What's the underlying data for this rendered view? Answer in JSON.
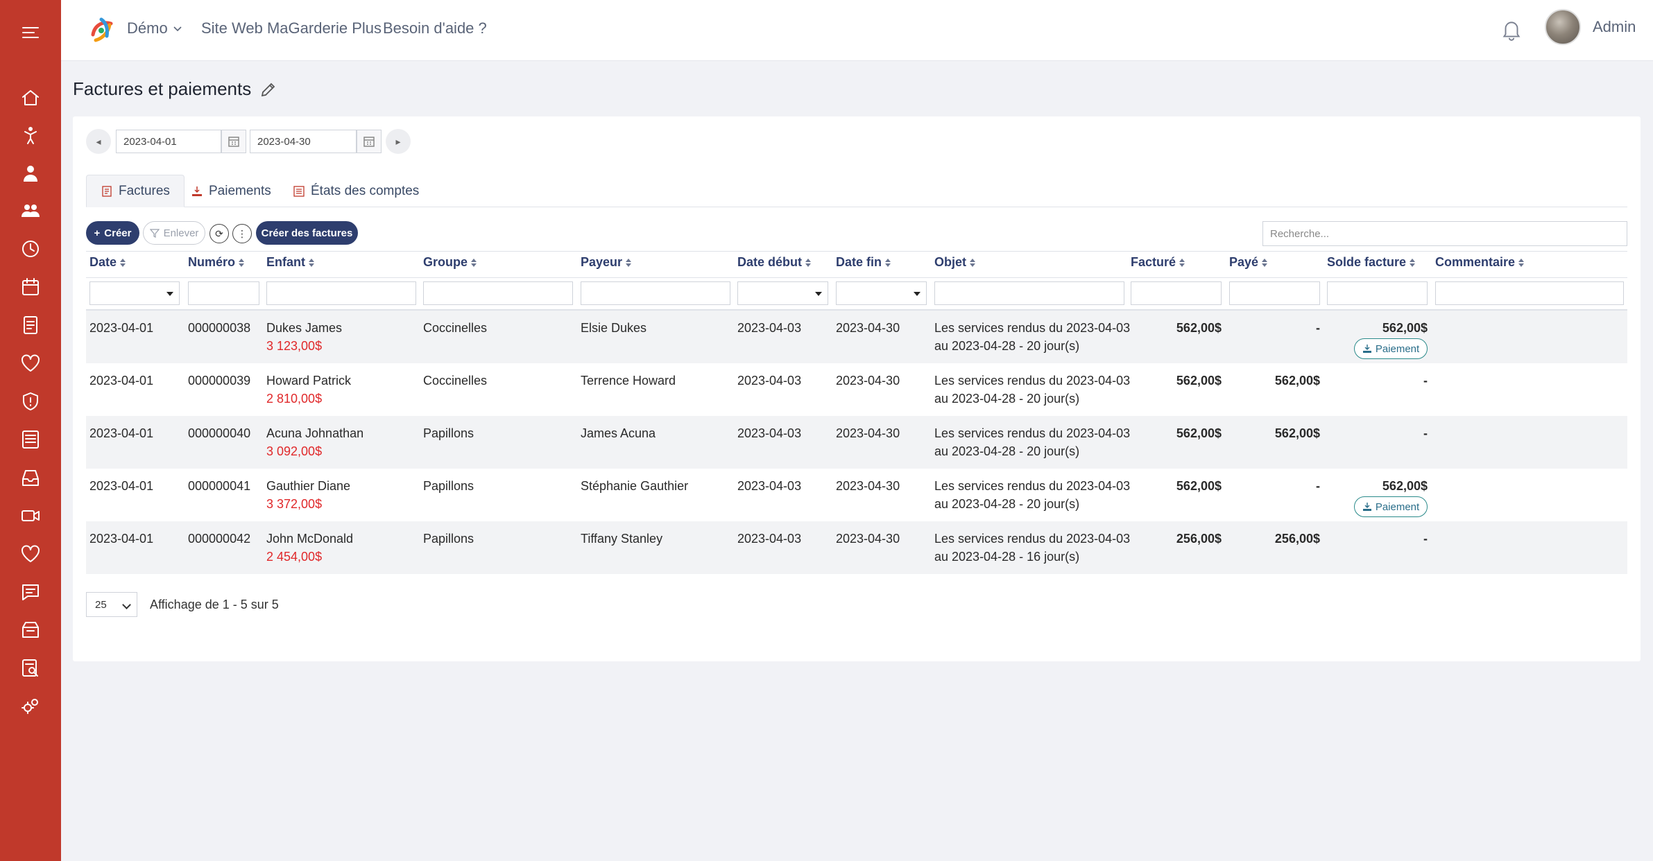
{
  "brand": {
    "name": "Démo"
  },
  "topnav": {
    "link1": "Site Web MaGarderie Plus",
    "link2": "Besoin d'aide ?",
    "user": "Admin"
  },
  "page": {
    "title": "Factures et paiements"
  },
  "dates": {
    "start": "2023-04-01",
    "end": "2023-04-30"
  },
  "tabs": [
    {
      "label": "Factures"
    },
    {
      "label": "Paiements"
    },
    {
      "label": "États des comptes"
    }
  ],
  "toolbar": {
    "create": "Créer",
    "remove": "Enlever",
    "create_invoices": "Créer des factures",
    "search_placeholder": "Recherche..."
  },
  "columns": [
    "Date",
    "Numéro",
    "Enfant",
    "Groupe",
    "Payeur",
    "Date début",
    "Date fin",
    "Objet",
    "Facturé",
    "Payé",
    "Solde facture",
    "Commentaire"
  ],
  "rows": [
    {
      "date": "2023-04-01",
      "numero": "000000038",
      "enfant": "Dukes James",
      "solde_enfant": "3 123,00$",
      "groupe": "Coccinelles",
      "payeur": "Elsie Dukes",
      "debut": "2023-04-03",
      "fin": "2023-04-30",
      "objet1": "Les services rendus du 2023-04-03",
      "objet2": "au 2023-04-28 - 20 jour(s)",
      "facture": "562,00$",
      "paye": "-",
      "solde": "562,00$",
      "paiement": "Paiement"
    },
    {
      "date": "2023-04-01",
      "numero": "000000039",
      "enfant": "Howard Patrick",
      "solde_enfant": "2 810,00$",
      "groupe": "Coccinelles",
      "payeur": "Terrence Howard",
      "debut": "2023-04-03",
      "fin": "2023-04-30",
      "objet1": "Les services rendus du 2023-04-03",
      "objet2": "au 2023-04-28 - 20 jour(s)",
      "facture": "562,00$",
      "paye": "562,00$",
      "solde": "-",
      "paiement": ""
    },
    {
      "date": "2023-04-01",
      "numero": "000000040",
      "enfant": "Acuna Johnathan",
      "solde_enfant": "3 092,00$",
      "groupe": "Papillons",
      "payeur": "James Acuna",
      "debut": "2023-04-03",
      "fin": "2023-04-30",
      "objet1": "Les services rendus du 2023-04-03",
      "objet2": "au 2023-04-28 - 20 jour(s)",
      "facture": "562,00$",
      "paye": "562,00$",
      "solde": "-",
      "paiement": ""
    },
    {
      "date": "2023-04-01",
      "numero": "000000041",
      "enfant": "Gauthier Diane",
      "solde_enfant": "3 372,00$",
      "groupe": "Papillons",
      "payeur": "Stéphanie Gauthier",
      "debut": "2023-04-03",
      "fin": "2023-04-30",
      "objet1": "Les services rendus du 2023-04-03",
      "objet2": "au 2023-04-28 - 20 jour(s)",
      "facture": "562,00$",
      "paye": "-",
      "solde": "562,00$",
      "paiement": "Paiement"
    },
    {
      "date": "2023-04-01",
      "numero": "000000042",
      "enfant": "John McDonald",
      "solde_enfant": "2 454,00$",
      "groupe": "Papillons",
      "payeur": "Tiffany Stanley",
      "debut": "2023-04-03",
      "fin": "2023-04-30",
      "objet1": "Les services rendus du 2023-04-03",
      "objet2": "au 2023-04-28 - 16 jour(s)",
      "facture": "256,00$",
      "paye": "256,00$",
      "solde": "-",
      "paiement": ""
    }
  ],
  "pagination": {
    "page_size": "25",
    "info": "Affichage de 1 - 5 sur 5"
  },
  "colors": {
    "sidebar": "#c0392b",
    "primary": "#2e3e6e",
    "negative": "#e0282a"
  },
  "icons": [
    "menu-icon",
    "home-icon",
    "child-icon",
    "staff-icon",
    "group-icon",
    "clock-icon",
    "calendar-icon",
    "invoice-icon",
    "heart-icon",
    "shield-icon",
    "report-icon",
    "inbox-icon",
    "video-icon",
    "heart-icon",
    "message-icon",
    "archive-icon",
    "search-report-icon",
    "gears-icon",
    "bell-icon",
    "pencil-icon"
  ]
}
